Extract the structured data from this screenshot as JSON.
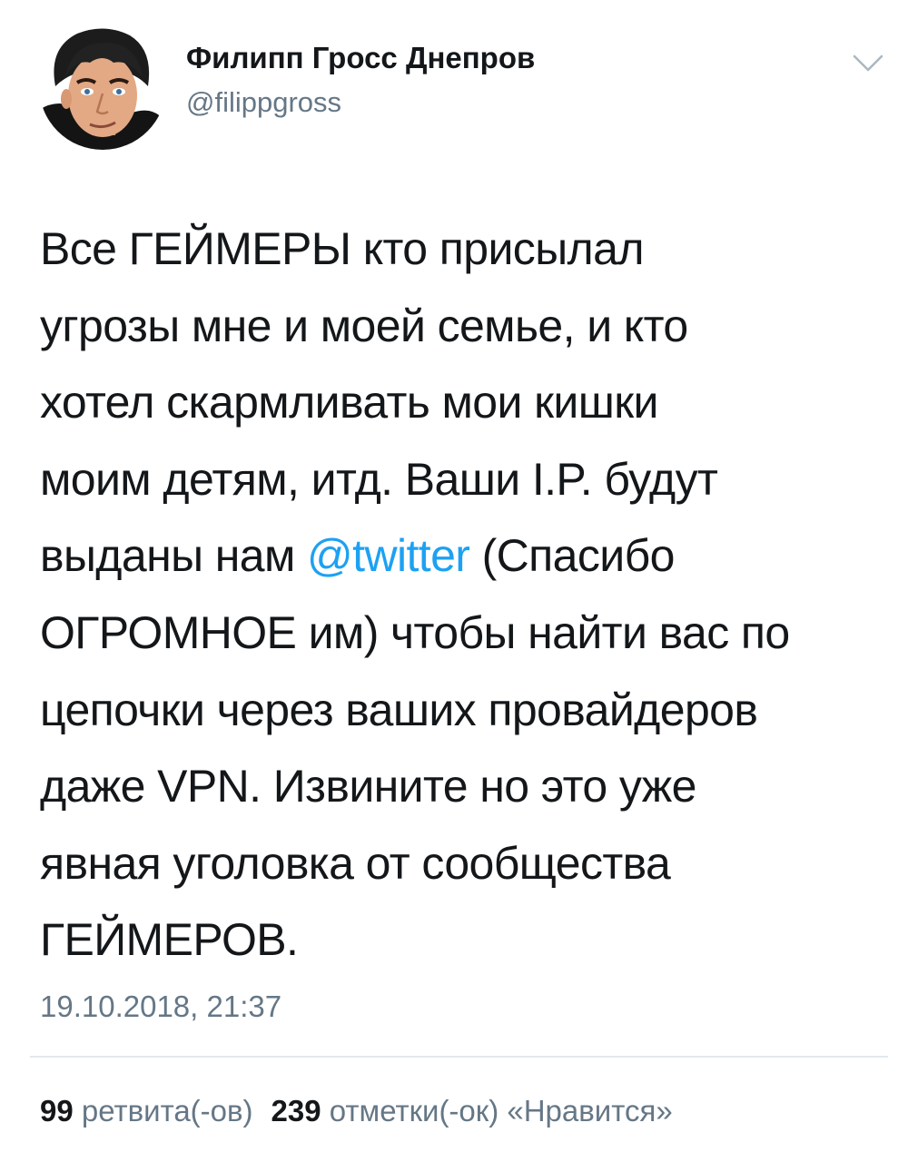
{
  "author": {
    "display_name": "Филипп Гросс Днепров",
    "handle": "@filippgross",
    "avatar_icon": "user-avatar"
  },
  "menu": {
    "icon": "chevron-down-icon",
    "color": "#aab8c2"
  },
  "tweet": {
    "lines": [
      [
        "Все ГЕЙМЕРЫ кто присылал"
      ],
      [
        "угрозы мне и моей семье, и кто"
      ],
      [
        "хотел скармливать мои кишки"
      ],
      [
        "моим детям, итд. Ваши I.P. будут"
      ],
      [
        "выданы нам ",
        "@twitter",
        " (Спасибо"
      ],
      [
        "ОГРОМНОЕ им) чтобы найти вас по"
      ],
      [
        "цепочки через ваших провайдеров"
      ],
      [
        "даже VPN. Извините но это уже"
      ],
      [
        "явная уголовка от сообщества"
      ],
      [
        "ГЕЙМЕРОВ."
      ]
    ],
    "mention": "@twitter",
    "mention_color": "#1da1f2",
    "timestamp": "19.10.2018, 21:37"
  },
  "stats": {
    "retweets_count": "99",
    "retweets_label": "ретвита(-ов)",
    "likes_count": "239",
    "likes_label": "отметки(-ок) «Нравится»"
  },
  "colors": {
    "text": "#14171a",
    "secondary": "#657786",
    "divider": "#e1e8ed"
  }
}
